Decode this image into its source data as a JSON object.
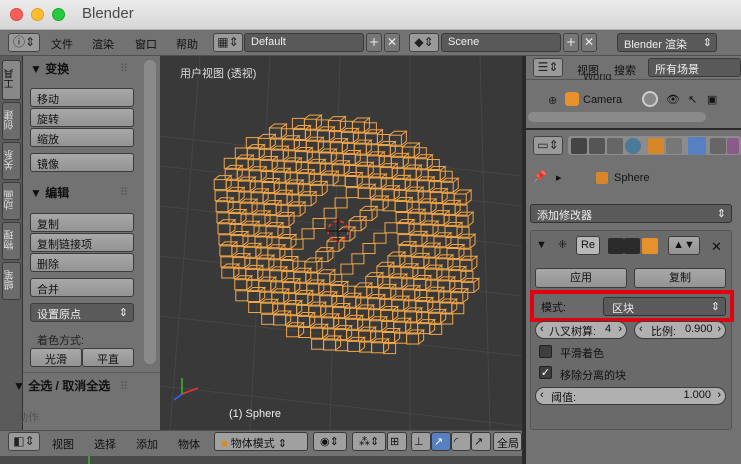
{
  "window": {
    "title": "Blender"
  },
  "infobar": {
    "menus": [
      "文件",
      "渲染",
      "窗口",
      "帮助"
    ],
    "screen_layout": "Default",
    "scene": "Scene",
    "engine": "Blender 渲染"
  },
  "toolshelf": {
    "tabs": [
      "工具",
      "创建",
      "关系",
      "动画",
      "物理",
      "蜡笔"
    ],
    "transform": {
      "title": "▼ 变换",
      "buttons": [
        "移动",
        "旋转",
        "缩放"
      ],
      "mirror": "镜像"
    },
    "edit": {
      "title": "▼ 编辑",
      "buttons": [
        "复制",
        "复制链接项",
        "删除"
      ],
      "join": "合并",
      "origin": "设置原点"
    },
    "shading": {
      "label": "着色方式:",
      "smooth": "光滑",
      "flat": "平直"
    },
    "select": {
      "title": "▼ 全选 / 取消全选",
      "action": "动作"
    }
  },
  "viewport": {
    "title": "用户视图 (透视)",
    "object_label": "(1) Sphere"
  },
  "bottombar": {
    "menus": [
      "视图",
      "选择",
      "添加",
      "物体"
    ],
    "mode": "物体模式",
    "global": "全局"
  },
  "outliner": {
    "menus": [
      "视图",
      "搜索"
    ],
    "filter": "所有场景",
    "items": [
      "World",
      "Camera"
    ]
  },
  "properties": {
    "object_name": "Sphere",
    "add_modifier": "添加修改器",
    "modifier_name": "Re",
    "apply": "应用",
    "copy": "复制",
    "mode_label": "模式:",
    "mode_value": "区块",
    "octree_label": "八叉树算:",
    "octree_value": "4",
    "scale_label": "比例:",
    "scale_value": "0.900",
    "smooth_shading": "平滑着色",
    "remove_disconnected": "移除分离的块",
    "threshold_label": "阈值:",
    "threshold_value": "1.000"
  },
  "colors": {
    "highlight_box": "#e0000f",
    "wire": "#f2a648",
    "active_tab": "#5680c2"
  }
}
